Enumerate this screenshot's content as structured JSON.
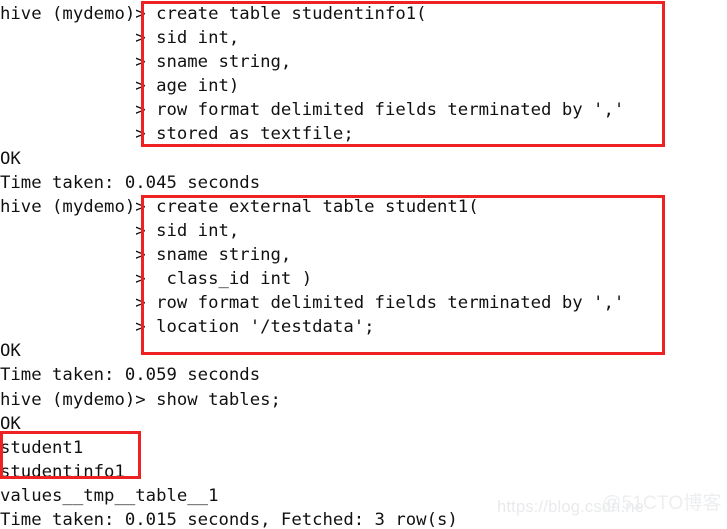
{
  "terminal": {
    "prompt": "hive (mydemo)>",
    "continuation": ">",
    "lines": [
      "hive (mydemo)> create table studentinfo1(",
      "             > sid int,",
      "             > sname string,",
      "             > age int)",
      "             > row format delimited fields terminated by ','",
      "             > stored as textfile;",
      "OK",
      "Time taken: 0.045 seconds",
      "hive (mydemo)> create external table student1(",
      "             > sid int,",
      "             > sname string,",
      "             >  class_id int )",
      "             > row format delimited fields terminated by ','",
      "             > location '/testdata';",
      "OK",
      "Time taken: 0.059 seconds",
      "hive (mydemo)> show tables;",
      "OK",
      "student1",
      "studentinfo1",
      "values__tmp__table__1",
      "Time taken: 0.015 seconds, Fetched: 3 row(s)"
    ]
  },
  "annotations": {
    "color": "#ee2222",
    "boxes": [
      {
        "name": "create-table-statement",
        "label": "create table studentinfo1"
      },
      {
        "name": "create-external-table-statement",
        "label": "create external table student1"
      },
      {
        "name": "table-list-result",
        "label": "student1 / studentinfo1"
      }
    ]
  },
  "watermarks": {
    "csdn": "https://blog.csdn.ne",
    "cto": "@51CTO博客"
  }
}
